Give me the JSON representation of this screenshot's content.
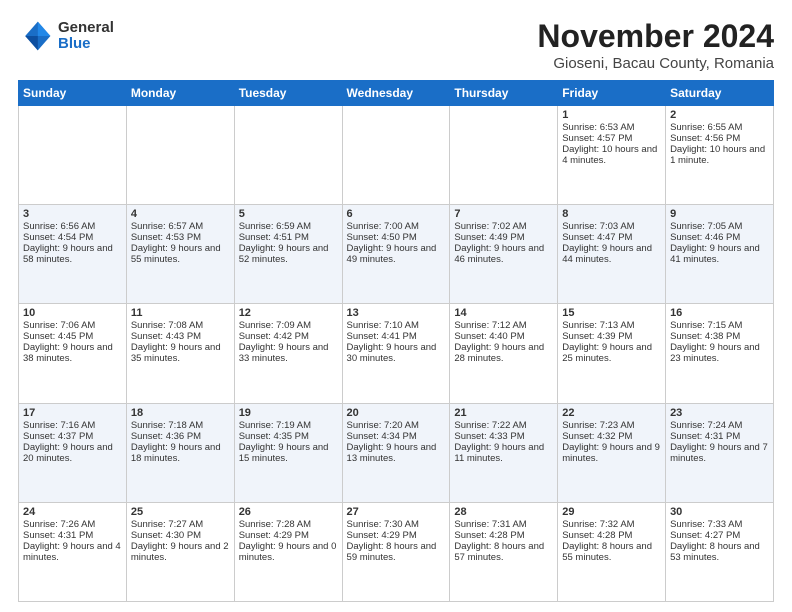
{
  "header": {
    "logo_general": "General",
    "logo_blue": "Blue",
    "main_title": "November 2024",
    "subtitle": "Gioseni, Bacau County, Romania"
  },
  "weekdays": [
    "Sunday",
    "Monday",
    "Tuesday",
    "Wednesday",
    "Thursday",
    "Friday",
    "Saturday"
  ],
  "weeks": [
    [
      {
        "day": "",
        "text": ""
      },
      {
        "day": "",
        "text": ""
      },
      {
        "day": "",
        "text": ""
      },
      {
        "day": "",
        "text": ""
      },
      {
        "day": "",
        "text": ""
      },
      {
        "day": "1",
        "text": "Sunrise: 6:53 AM\nSunset: 4:57 PM\nDaylight: 10 hours and 4 minutes."
      },
      {
        "day": "2",
        "text": "Sunrise: 6:55 AM\nSunset: 4:56 PM\nDaylight: 10 hours and 1 minute."
      }
    ],
    [
      {
        "day": "3",
        "text": "Sunrise: 6:56 AM\nSunset: 4:54 PM\nDaylight: 9 hours and 58 minutes."
      },
      {
        "day": "4",
        "text": "Sunrise: 6:57 AM\nSunset: 4:53 PM\nDaylight: 9 hours and 55 minutes."
      },
      {
        "day": "5",
        "text": "Sunrise: 6:59 AM\nSunset: 4:51 PM\nDaylight: 9 hours and 52 minutes."
      },
      {
        "day": "6",
        "text": "Sunrise: 7:00 AM\nSunset: 4:50 PM\nDaylight: 9 hours and 49 minutes."
      },
      {
        "day": "7",
        "text": "Sunrise: 7:02 AM\nSunset: 4:49 PM\nDaylight: 9 hours and 46 minutes."
      },
      {
        "day": "8",
        "text": "Sunrise: 7:03 AM\nSunset: 4:47 PM\nDaylight: 9 hours and 44 minutes."
      },
      {
        "day": "9",
        "text": "Sunrise: 7:05 AM\nSunset: 4:46 PM\nDaylight: 9 hours and 41 minutes."
      }
    ],
    [
      {
        "day": "10",
        "text": "Sunrise: 7:06 AM\nSunset: 4:45 PM\nDaylight: 9 hours and 38 minutes."
      },
      {
        "day": "11",
        "text": "Sunrise: 7:08 AM\nSunset: 4:43 PM\nDaylight: 9 hours and 35 minutes."
      },
      {
        "day": "12",
        "text": "Sunrise: 7:09 AM\nSunset: 4:42 PM\nDaylight: 9 hours and 33 minutes."
      },
      {
        "day": "13",
        "text": "Sunrise: 7:10 AM\nSunset: 4:41 PM\nDaylight: 9 hours and 30 minutes."
      },
      {
        "day": "14",
        "text": "Sunrise: 7:12 AM\nSunset: 4:40 PM\nDaylight: 9 hours and 28 minutes."
      },
      {
        "day": "15",
        "text": "Sunrise: 7:13 AM\nSunset: 4:39 PM\nDaylight: 9 hours and 25 minutes."
      },
      {
        "day": "16",
        "text": "Sunrise: 7:15 AM\nSunset: 4:38 PM\nDaylight: 9 hours and 23 minutes."
      }
    ],
    [
      {
        "day": "17",
        "text": "Sunrise: 7:16 AM\nSunset: 4:37 PM\nDaylight: 9 hours and 20 minutes."
      },
      {
        "day": "18",
        "text": "Sunrise: 7:18 AM\nSunset: 4:36 PM\nDaylight: 9 hours and 18 minutes."
      },
      {
        "day": "19",
        "text": "Sunrise: 7:19 AM\nSunset: 4:35 PM\nDaylight: 9 hours and 15 minutes."
      },
      {
        "day": "20",
        "text": "Sunrise: 7:20 AM\nSunset: 4:34 PM\nDaylight: 9 hours and 13 minutes."
      },
      {
        "day": "21",
        "text": "Sunrise: 7:22 AM\nSunset: 4:33 PM\nDaylight: 9 hours and 11 minutes."
      },
      {
        "day": "22",
        "text": "Sunrise: 7:23 AM\nSunset: 4:32 PM\nDaylight: 9 hours and 9 minutes."
      },
      {
        "day": "23",
        "text": "Sunrise: 7:24 AM\nSunset: 4:31 PM\nDaylight: 9 hours and 7 minutes."
      }
    ],
    [
      {
        "day": "24",
        "text": "Sunrise: 7:26 AM\nSunset: 4:31 PM\nDaylight: 9 hours and 4 minutes."
      },
      {
        "day": "25",
        "text": "Sunrise: 7:27 AM\nSunset: 4:30 PM\nDaylight: 9 hours and 2 minutes."
      },
      {
        "day": "26",
        "text": "Sunrise: 7:28 AM\nSunset: 4:29 PM\nDaylight: 9 hours and 0 minutes."
      },
      {
        "day": "27",
        "text": "Sunrise: 7:30 AM\nSunset: 4:29 PM\nDaylight: 8 hours and 59 minutes."
      },
      {
        "day": "28",
        "text": "Sunrise: 7:31 AM\nSunset: 4:28 PM\nDaylight: 8 hours and 57 minutes."
      },
      {
        "day": "29",
        "text": "Sunrise: 7:32 AM\nSunset: 4:28 PM\nDaylight: 8 hours and 55 minutes."
      },
      {
        "day": "30",
        "text": "Sunrise: 7:33 AM\nSunset: 4:27 PM\nDaylight: 8 hours and 53 minutes."
      }
    ]
  ]
}
